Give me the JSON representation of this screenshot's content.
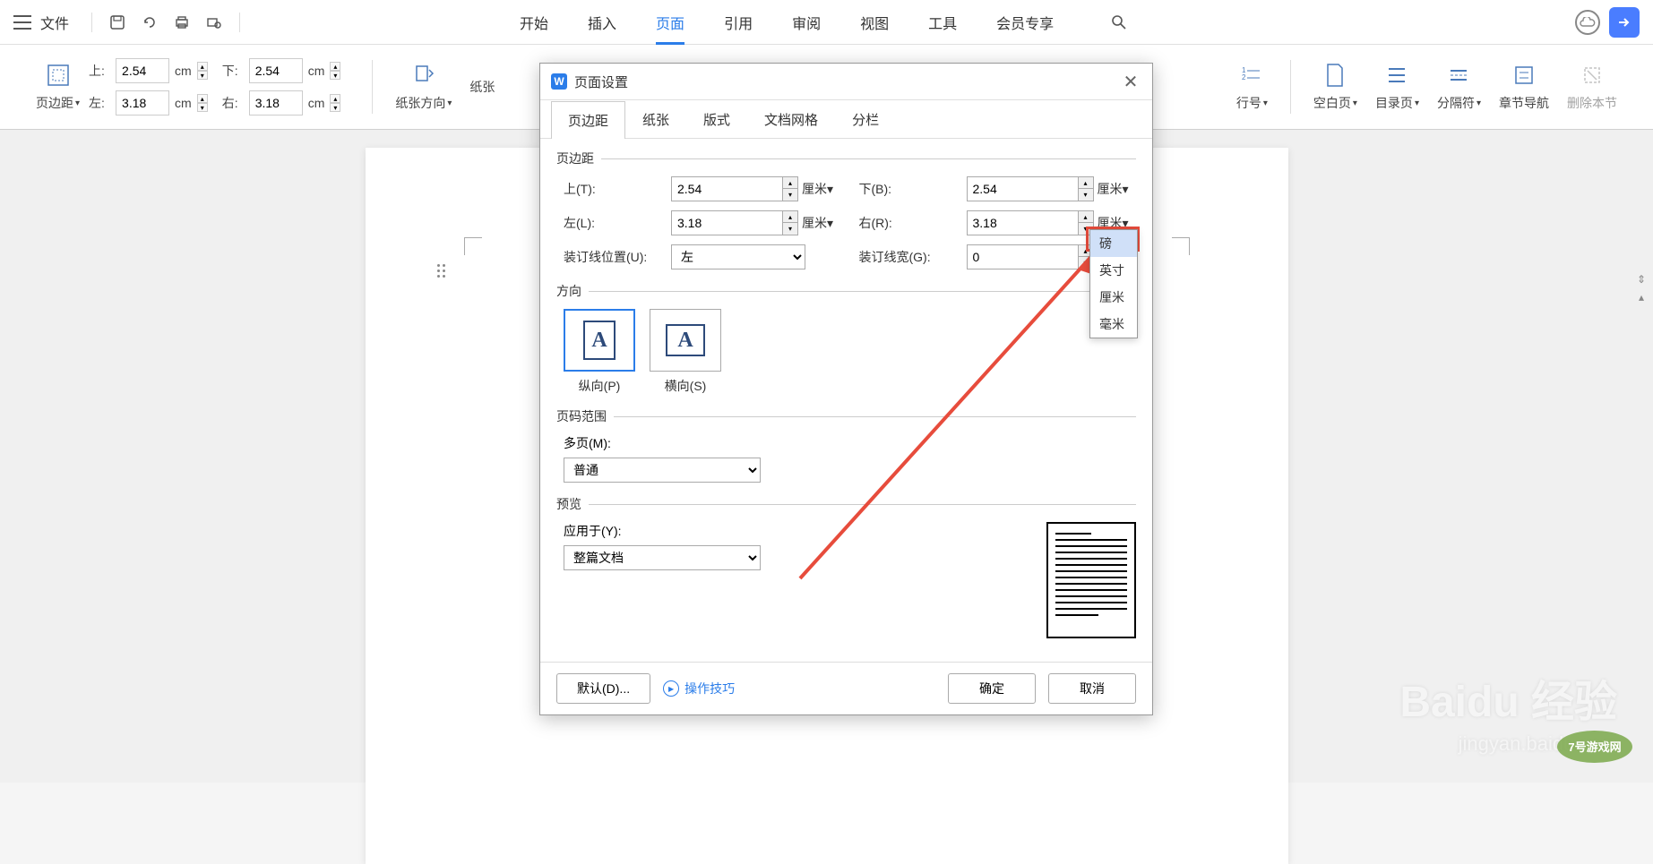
{
  "topbar": {
    "file": "文件"
  },
  "tabs": [
    "开始",
    "插入",
    "页面",
    "引用",
    "审阅",
    "视图",
    "工具",
    "会员专享"
  ],
  "active_tab": "页面",
  "ribbon": {
    "margins_btn": "页边距",
    "top_label": "上:",
    "top_value": "2.54",
    "bottom_label": "下:",
    "bottom_value": "2.54",
    "left_label": "左:",
    "left_value": "3.18",
    "right_label": "右:",
    "right_value": "3.18",
    "unit": "cm",
    "orientation": "纸张方向",
    "paper": "纸张",
    "line_no": "行号",
    "blank_page": "空白页",
    "toc_page": "目录页",
    "separator": "分隔符",
    "chapter_nav": "章节导航",
    "delete_section": "删除本节"
  },
  "dialog": {
    "title": "页面设置",
    "tabs": [
      "页边距",
      "纸张",
      "版式",
      "文档网格",
      "分栏"
    ],
    "active_tab": "页边距",
    "margins_legend": "页边距",
    "top_label": "上(T):",
    "top_value": "2.54",
    "bottom_label": "下(B):",
    "bottom_value": "2.54",
    "left_label": "左(L):",
    "left_value": "3.18",
    "right_label": "右(R):",
    "right_value": "3.18",
    "unit": "厘米",
    "gutter_pos_label": "装订线位置(U):",
    "gutter_pos_value": "左",
    "gutter_width_label": "装订线宽(G):",
    "gutter_width_value": "0",
    "orientation_legend": "方向",
    "portrait": "纵向(P)",
    "landscape": "横向(S)",
    "page_range_legend": "页码范围",
    "multi_label": "多页(M):",
    "multi_value": "普通",
    "preview_legend": "预览",
    "apply_label": "应用于(Y):",
    "apply_value": "整篇文档",
    "default_btn": "默认(D)...",
    "tips": "操作技巧",
    "ok": "确定",
    "cancel": "取消"
  },
  "unit_options": [
    "磅",
    "英寸",
    "厘米",
    "毫米"
  ],
  "watermark": {
    "brand": "Baidu 经验",
    "sub": "jingyan.baidu.com",
    "logo": "7号游戏网"
  }
}
